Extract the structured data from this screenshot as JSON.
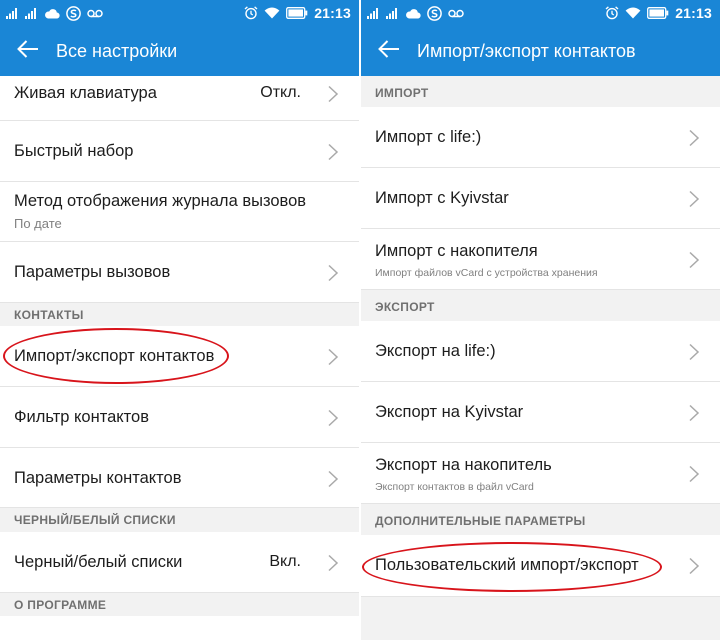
{
  "status_bar": {
    "time": "21:13",
    "left_icons": [
      "signal-icon",
      "signal-icon",
      "cloud-icon",
      "app-s-icon",
      "voicemail-icon"
    ],
    "right_icons": [
      "alarm-icon",
      "wifi-icon",
      "battery-icon"
    ]
  },
  "colors": {
    "header": "#1a86d6",
    "annotation": "#d8141b",
    "section_bg": "#f2f2f2",
    "section_text": "#707070",
    "subtext": "#808080"
  },
  "left": {
    "title": "Все настройки",
    "rows": {
      "live_keyboard": {
        "title": "Живая клавиатура",
        "value": "Откл."
      },
      "speed_dial": {
        "title": "Быстрый набор"
      },
      "call_log_method": {
        "title": "Метод отображения журнала вызовов",
        "subtitle": "По дате"
      },
      "call_settings": {
        "title": "Параметры вызовов"
      },
      "import_export": {
        "title": "Импорт/экспорт контактов"
      },
      "contact_filter": {
        "title": "Фильтр контактов"
      },
      "contact_settings": {
        "title": "Параметры контактов"
      },
      "blacklist": {
        "title": "Черный/белый списки",
        "value": "Вкл."
      }
    },
    "sections": {
      "contacts": "КОНТАКТЫ",
      "blacklist": "ЧЕРНЫЙ/БЕЛЫЙ СПИСКИ",
      "about": "О ПРОГРАММЕ"
    }
  },
  "right": {
    "title": "Импорт/экспорт контактов",
    "sections": {
      "import": "ИМПОРТ",
      "export": "ЭКСПОРТ",
      "advanced": "ДОПОЛНИТЕЛЬНЫЕ ПАРАМЕТРЫ"
    },
    "rows": {
      "import_life": {
        "title": "Импорт с life:)"
      },
      "import_kyivstar": {
        "title": "Импорт с Kyivstar"
      },
      "import_storage": {
        "title": "Импорт с накопителя",
        "subtitle": "Импорт файлов vCard с устройства хранения"
      },
      "export_life": {
        "title": "Экспорт на life:)"
      },
      "export_kyivstar": {
        "title": "Экспорт на Kyivstar"
      },
      "export_storage": {
        "title": "Экспорт на накопитель",
        "subtitle": "Экспорт контактов в файл vCard"
      },
      "custom": {
        "title": "Пользовательский импорт/экспорт"
      }
    }
  }
}
